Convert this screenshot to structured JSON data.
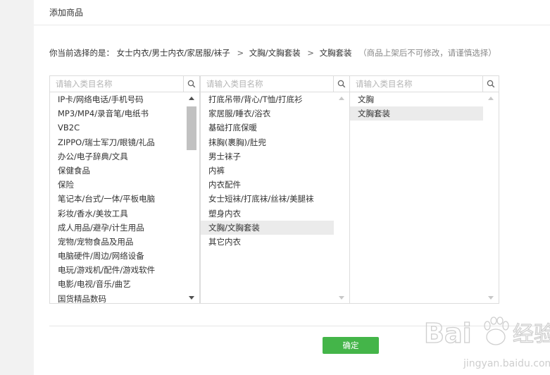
{
  "header": {
    "title": "添加商品"
  },
  "selection": {
    "prefix": "你当前选择的是：",
    "path": [
      "女士内衣/男士内衣/家居服/袜子",
      "文胸/文胸套装",
      "文胸套装"
    ],
    "separator": ">",
    "note": "（商品上架后不可修改，请谨慎选择）"
  },
  "columns": [
    {
      "placeholder": "请输入类目名称",
      "items": [
        "IP卡/网络电话/手机号码",
        "MP3/MP4/录音笔/电纸书",
        "VB2C",
        "ZIPPO/瑞士军刀/眼镜/礼品",
        "办公/电子辞典/文具",
        "保健食品",
        "保险",
        "笔记本/台式/一体/平板电脑",
        "彩妆/香水/美妆工具",
        "成人用品/避孕/计生用品",
        "宠物/宠物食品及用品",
        "电脑硬件/周边/网络设备",
        "电玩/游戏机/配件/游戏软件",
        "电影/电视/音乐/曲艺",
        "国货精品数码"
      ],
      "selected_index": -1,
      "scroll_position": 0
    },
    {
      "placeholder": "请输入类目名称",
      "items": [
        "打底吊带/背心/T恤/打底衫",
        "家居服/睡衣/浴衣",
        "基础打底保暖",
        "抹胸(裹胸)/肚兜",
        "男士袜子",
        "内裤",
        "内衣配件",
        "女士短袜/打底袜/丝袜/美腿袜",
        "塑身内衣",
        "文胸/文胸套装",
        "其它内衣"
      ],
      "selected_index": 9
    },
    {
      "placeholder": "请输入类目名称",
      "items": [
        "文胸",
        "文胸套装"
      ],
      "selected_index": 1
    }
  ],
  "footer": {
    "confirm_label": "确定"
  },
  "watermark": {
    "text": "Bai",
    "text2": "经验",
    "url": "jingyan.baidu.com"
  },
  "colors": {
    "accent": "#44b549",
    "selected_row": "#ebebeb",
    "border": "#dcdcdc"
  }
}
